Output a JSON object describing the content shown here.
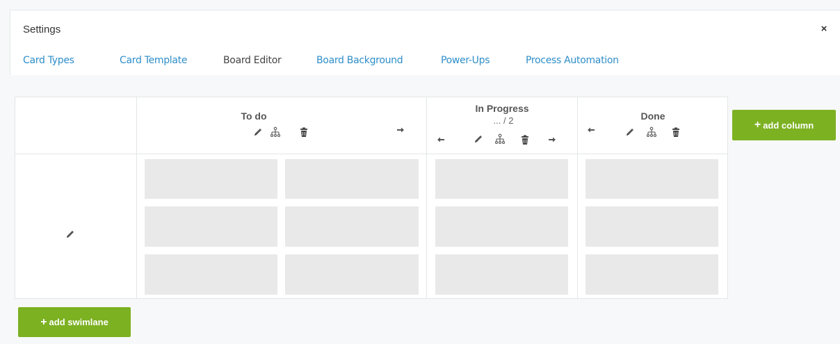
{
  "dialog": {
    "title": "Settings",
    "close_label": "×"
  },
  "tabs": [
    {
      "label": "Card Types",
      "active": false
    },
    {
      "label": "Card Template",
      "active": false
    },
    {
      "label": "Board Editor",
      "active": true
    },
    {
      "label": "Board Background",
      "active": false
    },
    {
      "label": "Power-Ups",
      "active": false
    },
    {
      "label": "Process Automation",
      "active": false
    }
  ],
  "columns": [
    {
      "title": "To do",
      "wip": "",
      "icons": [
        "pencil-icon",
        "hierarchy-icon",
        "trash-icon",
        "arrow-right-icon"
      ]
    },
    {
      "title": "In Progress",
      "wip": "... / 2",
      "icons": [
        "arrow-left-icon",
        "pencil-icon",
        "hierarchy-icon",
        "trash-icon",
        "arrow-right-icon"
      ]
    },
    {
      "title": "Done",
      "wip": "",
      "icons": [
        "arrow-left-icon",
        "pencil-icon",
        "hierarchy-icon",
        "trash-icon"
      ]
    }
  ],
  "swimlanes": [
    {
      "icons": [
        "pencil-icon"
      ]
    }
  ],
  "buttons": {
    "add_column": "add column",
    "add_swimlane": "add swimlane",
    "plus": "+"
  },
  "colors": {
    "accent_green": "#7cb122",
    "tab_link": "#2e8ec9",
    "card_placeholder": "#e9e9e9"
  }
}
